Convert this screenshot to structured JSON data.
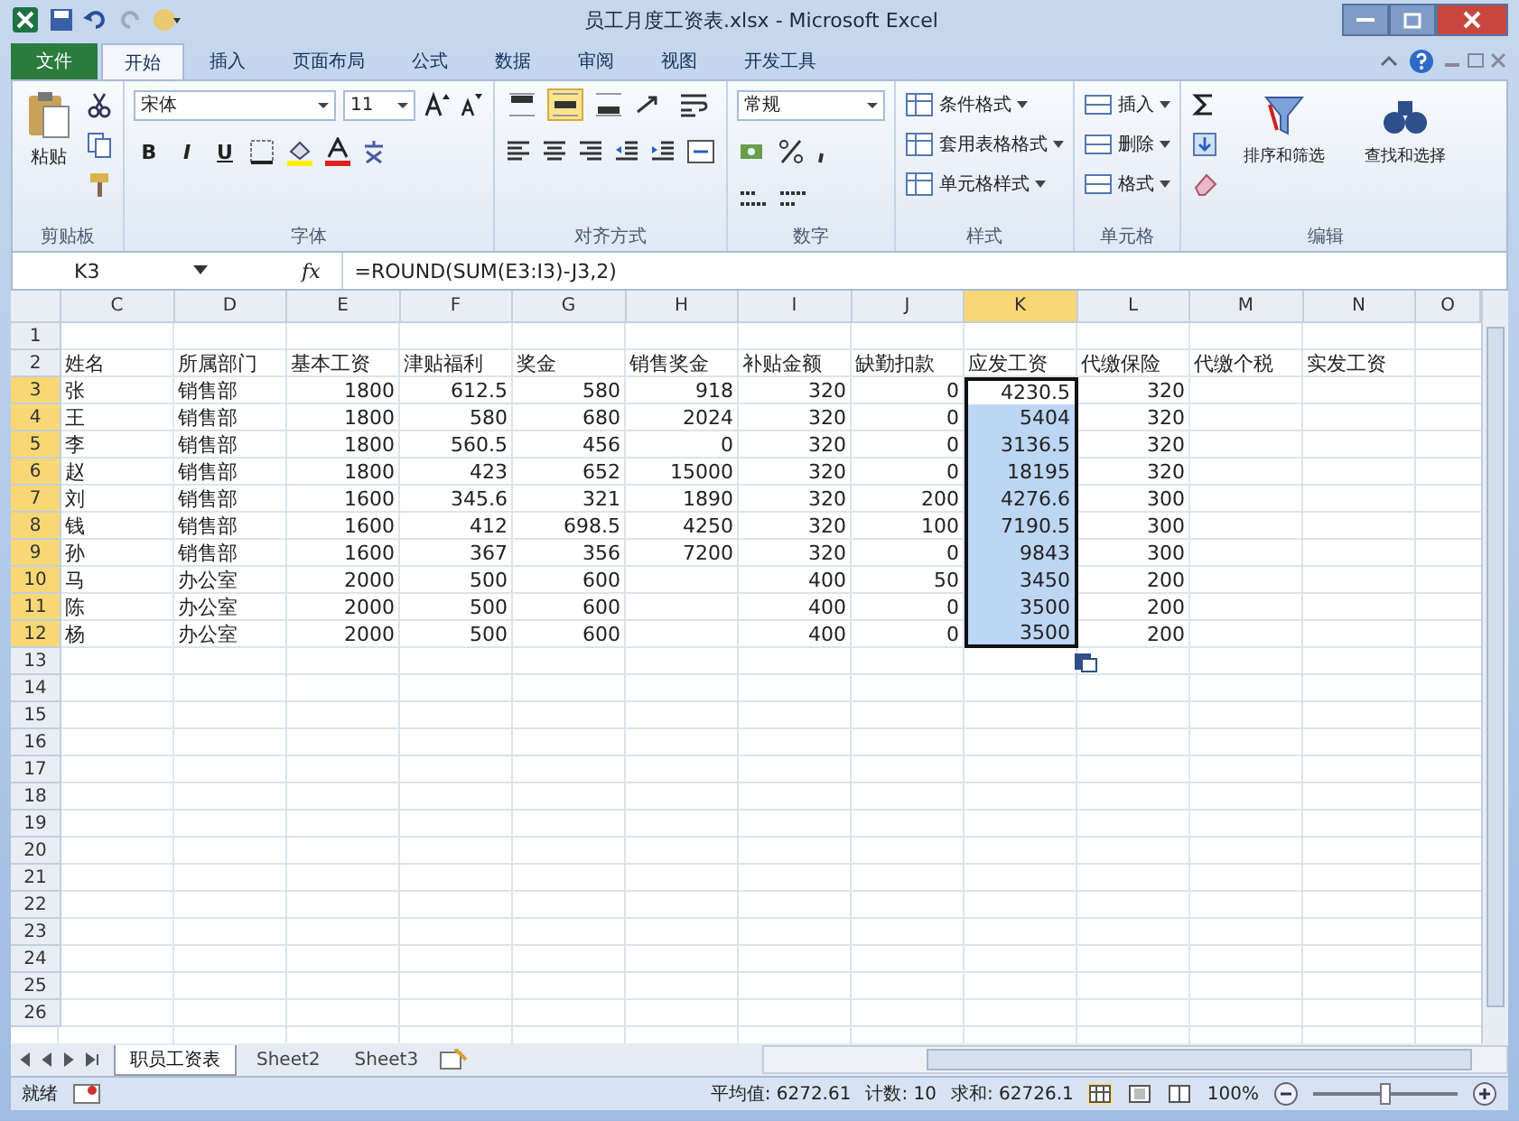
{
  "window": {
    "title": "员工月度工资表.xlsx - Microsoft Excel"
  },
  "ribbon_tabs": [
    {
      "label": "文件",
      "kind": "file",
      "selected": false
    },
    {
      "label": "开始",
      "kind": "tab",
      "selected": true
    },
    {
      "label": "插入",
      "kind": "tab",
      "selected": false
    },
    {
      "label": "页面布局",
      "kind": "tab",
      "selected": false
    },
    {
      "label": "公式",
      "kind": "tab",
      "selected": false
    },
    {
      "label": "数据",
      "kind": "tab",
      "selected": false
    },
    {
      "label": "审阅",
      "kind": "tab",
      "selected": false
    },
    {
      "label": "视图",
      "kind": "tab",
      "selected": false
    },
    {
      "label": "开发工具",
      "kind": "tab",
      "selected": false
    }
  ],
  "ribbon": {
    "clipboard": {
      "label": "剪贴板",
      "paste": "粘贴"
    },
    "font": {
      "label": "字体",
      "font_name": "宋体",
      "font_size": "11",
      "styles": [
        "B",
        "I",
        "U"
      ]
    },
    "alignment": {
      "label": "对齐方式",
      "vertical_align": [
        {
          "selected": false
        },
        {
          "selected": true
        },
        {
          "selected": false
        }
      ]
    },
    "number": {
      "label": "数字",
      "format": "常规"
    },
    "styles": {
      "label": "样式",
      "commands": [
        "条件格式",
        "套用表格格式",
        "单元格样式"
      ]
    },
    "cells": {
      "label": "单元格",
      "commands": [
        "插入",
        "删除",
        "格式"
      ]
    },
    "editing": {
      "label": "编辑",
      "commands": [
        "排序和筛选",
        "查找和选择"
      ]
    }
  },
  "formula_bar": {
    "name_box": "K3",
    "function_label": "fx",
    "formula": "=ROUND(SUM(E3:I3)-J3,2)"
  },
  "columns": [
    {
      "label": "C",
      "selected": false
    },
    {
      "label": "D",
      "selected": false
    },
    {
      "label": "E",
      "selected": false
    },
    {
      "label": "F",
      "selected": false
    },
    {
      "label": "G",
      "selected": false
    },
    {
      "label": "H",
      "selected": false
    },
    {
      "label": "I",
      "selected": false
    },
    {
      "label": "J",
      "selected": false
    },
    {
      "label": "K",
      "selected": true
    },
    {
      "label": "L",
      "selected": false
    },
    {
      "label": "M",
      "selected": false
    },
    {
      "label": "N",
      "selected": false
    },
    {
      "label": "O",
      "selected": false
    }
  ],
  "rows": [
    {
      "number": "1",
      "selected": false
    },
    {
      "number": "2",
      "selected": false,
      "cells": [
        "姓名",
        "所属部门",
        "基本工资",
        "津贴福利",
        "奖金",
        "销售奖金",
        "补贴金额",
        "缺勤扣款",
        "应发工资",
        "代缴保险",
        "代缴个税",
        "实发工资"
      ]
    },
    {
      "number": "3",
      "selected": true,
      "cells": [
        "张",
        "销售部",
        "1800",
        "612.5",
        "580",
        "918",
        "320",
        "0",
        "4230.5",
        "320",
        null,
        null
      ]
    },
    {
      "number": "4",
      "selected": true,
      "cells": [
        "王",
        "销售部",
        "1800",
        "580",
        "680",
        "2024",
        "320",
        "0",
        "5404",
        "320",
        null,
        null
      ]
    },
    {
      "number": "5",
      "selected": true,
      "cells": [
        "李",
        "销售部",
        "1800",
        "560.5",
        "456",
        "0",
        "320",
        "0",
        "3136.5",
        "320",
        null,
        null
      ]
    },
    {
      "number": "6",
      "selected": true,
      "cells": [
        "赵",
        "销售部",
        "1800",
        "423",
        "652",
        "15000",
        "320",
        "0",
        "18195",
        "320",
        null,
        null
      ]
    },
    {
      "number": "7",
      "selected": true,
      "cells": [
        "刘",
        "销售部",
        "1600",
        "345.6",
        "321",
        "1890",
        "320",
        "200",
        "4276.6",
        "300",
        null,
        null
      ]
    },
    {
      "number": "8",
      "selected": true,
      "cells": [
        "钱",
        "销售部",
        "1600",
        "412",
        "698.5",
        "4250",
        "320",
        "100",
        "7190.5",
        "300",
        null,
        null
      ]
    },
    {
      "number": "9",
      "selected": true,
      "cells": [
        "孙",
        "销售部",
        "1600",
        "367",
        "356",
        "7200",
        "320",
        "0",
        "9843",
        "300",
        null,
        null
      ]
    },
    {
      "number": "10",
      "selected": true,
      "cells": [
        "马",
        "办公室",
        "2000",
        "500",
        "600",
        null,
        "400",
        "50",
        "3450",
        "200",
        null,
        null
      ]
    },
    {
      "number": "11",
      "selected": true,
      "cells": [
        "陈",
        "办公室",
        "2000",
        "500",
        "600",
        null,
        "400",
        "0",
        "3500",
        "200",
        null,
        null
      ]
    },
    {
      "number": "12",
      "selected": true,
      "cells": [
        "杨",
        "办公室",
        "2000",
        "500",
        "600",
        null,
        "400",
        "0",
        "3500",
        "200",
        null,
        null
      ]
    },
    {
      "number": "13",
      "selected": false
    },
    {
      "number": "14",
      "selected": false
    },
    {
      "number": "15",
      "selected": false
    },
    {
      "number": "16",
      "selected": false
    },
    {
      "number": "17",
      "selected": false
    },
    {
      "number": "18",
      "selected": false
    },
    {
      "number": "19",
      "selected": false
    },
    {
      "number": "20",
      "selected": false
    },
    {
      "number": "21",
      "selected": false
    },
    {
      "number": "22",
      "selected": false
    },
    {
      "number": "23",
      "selected": false
    },
    {
      "number": "24",
      "selected": false
    },
    {
      "number": "25",
      "selected": false
    },
    {
      "number": "26",
      "selected": false
    }
  ],
  "sheet_tabs": [
    {
      "label": "职员工资表",
      "selected": true
    },
    {
      "label": "Sheet2",
      "selected": false
    },
    {
      "label": "Sheet3",
      "selected": false
    }
  ],
  "status_bar": {
    "ready": "就绪",
    "average": "平均值: 6272.61",
    "count": "计数: 10",
    "sum": "求和: 62726.1",
    "zoom": "100%",
    "zoom_slider": {
      "level": 0.5
    }
  }
}
